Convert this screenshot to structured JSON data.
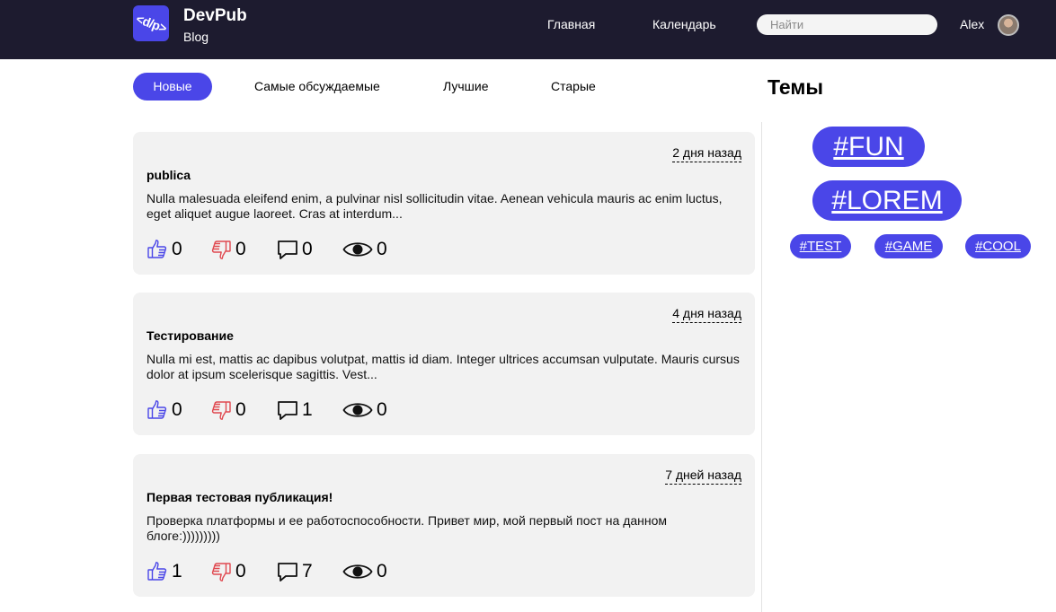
{
  "header": {
    "logo_text": "<d/p>",
    "brand_name": "DevPub",
    "brand_sub": "Blog",
    "nav": {
      "home": "Главная",
      "calendar": "Календарь"
    },
    "search_placeholder": "Найти",
    "user_name": "Alex",
    "colors": {
      "background": "#1d1b2f",
      "accent": "#4a46e8"
    }
  },
  "tabs": {
    "new": "Новые",
    "discussed": "Самые обсуждаемые",
    "best": "Лучшие",
    "old": "Старые"
  },
  "posts": [
    {
      "date": "2 дня назад",
      "title": "publica",
      "text": "Nulla malesuada eleifend enim, a pulvinar nisl sollicitudin vitae. Aenean vehicula mauris ac enim luctus, eget aliquet augue laoreet. Cras at interdum...",
      "likes": "0",
      "dislikes": "0",
      "comments": "0",
      "views": "0"
    },
    {
      "date": "4 дня назад",
      "title": "Тестирование",
      "text": "Nulla mi est, mattis ac dapibus volutpat, mattis id diam. Integer ultrices accumsan vulputate. Mauris cursus dolor at ipsum scelerisque sagittis. Vest...",
      "likes": "0",
      "dislikes": "0",
      "comments": "1",
      "views": "0"
    },
    {
      "date": "7 дней назад",
      "title": "Первая тестовая публикация!",
      "text": "Проверка платформы и ее работоспособности. Привет мир, мой первый пост на данном блоге:)))))))))",
      "likes": "1",
      "dislikes": "0",
      "comments": "7",
      "views": "0"
    }
  ],
  "topics": {
    "title": "Темы",
    "tags": [
      "#FUN",
      "#LOREM",
      "#TEST",
      "#GAME",
      "#COOL"
    ]
  },
  "icons": {
    "like": "thumbs-up-icon",
    "dislike": "thumbs-down-icon",
    "comments": "comment-icon",
    "views": "eye-icon",
    "like_color": "#4a46e8",
    "dislike_color": "#e0484f"
  }
}
